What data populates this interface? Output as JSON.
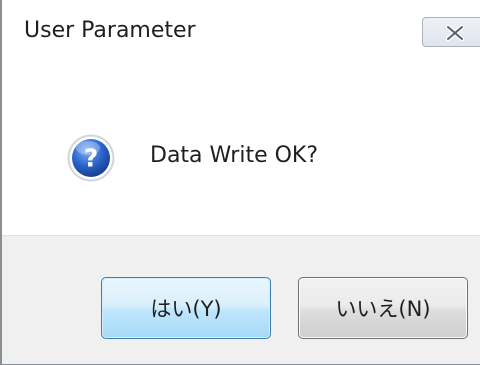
{
  "window": {
    "title": "User Parameter",
    "close_icon": "close-icon"
  },
  "dialog": {
    "icon": "question-icon",
    "message": "Data Write OK?"
  },
  "buttons": {
    "yes_label": "はい(Y)",
    "no_label": "いいえ(N)"
  },
  "colors": {
    "button_bar_bg": "#f0f0f0",
    "default_button_border": "#3c7fb1",
    "icon_blue": "#1f56b5"
  }
}
